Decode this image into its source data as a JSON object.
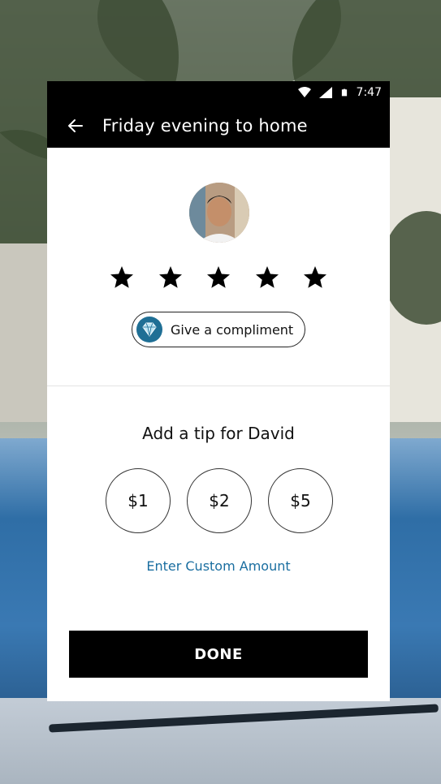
{
  "status_bar": {
    "time": "7:47"
  },
  "app_bar": {
    "title": "Friday evening to home"
  },
  "rating": {
    "stars": 5
  },
  "compliment": {
    "label": "Give a compliment"
  },
  "tip": {
    "heading": "Add a tip for David",
    "options": [
      "$1",
      "$2",
      "$5"
    ],
    "custom_label": "Enter Custom Amount"
  },
  "done_button": {
    "label": "DONE"
  },
  "colors": {
    "accent_link": "#1a6ea0",
    "bar": "#000000"
  }
}
